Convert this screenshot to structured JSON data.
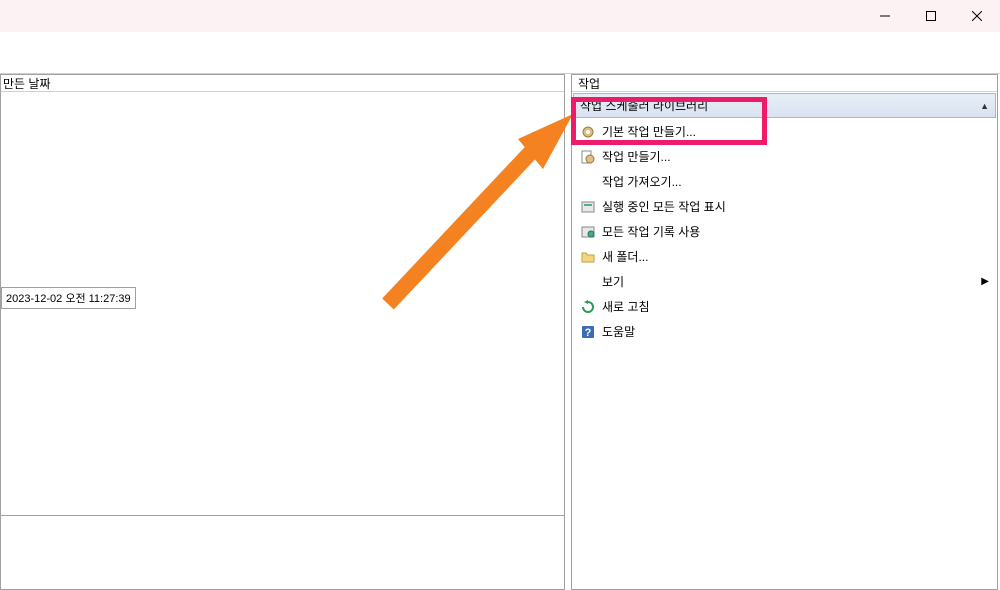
{
  "titlebar": {
    "minimize_tooltip": "최소화",
    "maximize_tooltip": "최대화",
    "close_tooltip": "닫기"
  },
  "left_pane": {
    "column_header": "만든 날짜",
    "date_value": "2023-12-02 오전 11:27:39"
  },
  "actions_pane": {
    "title": "작업",
    "section_label": "작업 스케줄러 라이브러리",
    "items": [
      {
        "label": "기본 작업 만들기...",
        "icon": "gear-icon"
      },
      {
        "label": "작업 만들기...",
        "icon": "gear-sheet-icon"
      },
      {
        "label": "작업 가져오기...",
        "icon": null
      },
      {
        "label": "실행 중인 모든 작업 표시",
        "icon": "running-tasks-icon"
      },
      {
        "label": "모든 작업 기록 사용",
        "icon": "history-icon"
      },
      {
        "label": "새 폴더...",
        "icon": "folder-icon"
      },
      {
        "label": "보기",
        "icon": null,
        "has_submenu": true
      },
      {
        "label": "새로 고침",
        "icon": "refresh-icon"
      },
      {
        "label": "도움말",
        "icon": "help-icon"
      }
    ]
  }
}
